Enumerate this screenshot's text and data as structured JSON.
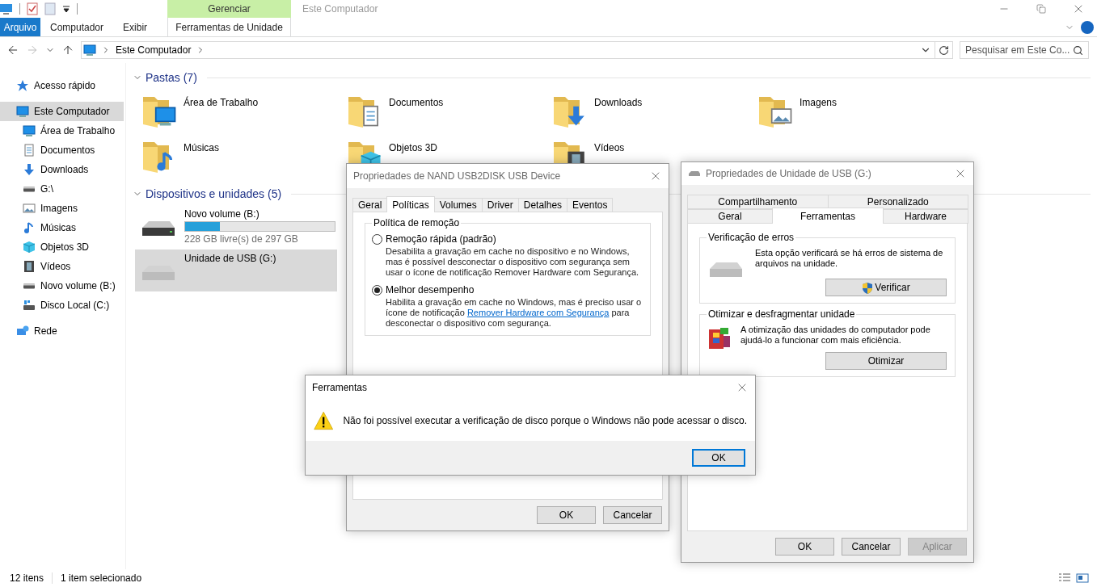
{
  "explorer": {
    "context_group": "Gerenciar",
    "title": "Este Computador",
    "ribbon_tabs": [
      {
        "label": "Arquivo",
        "kind": "file"
      },
      {
        "label": "Computador",
        "kind": "plain"
      },
      {
        "label": "Exibir",
        "kind": "plain"
      },
      {
        "label": "Ferramentas de Unidade",
        "kind": "context"
      }
    ],
    "address": {
      "path": [
        "Este Computador"
      ]
    },
    "search": {
      "placeholder": "Pesquisar em Este Co..."
    },
    "sidebar": {
      "items": [
        {
          "label": "Acesso rápido",
          "kind": "star",
          "selected": false
        },
        {
          "label": "Este Computador",
          "kind": "pc",
          "selected": true,
          "children": [
            {
              "label": "Área de Trabalho",
              "kind": "desktop",
              "selected": false
            },
            {
              "label": "Documentos",
              "kind": "documents",
              "selected": false
            },
            {
              "label": "Downloads",
              "kind": "downloads",
              "selected": false
            },
            {
              "label": "G:\\",
              "kind": "drive",
              "selected": false
            },
            {
              "label": "Imagens",
              "kind": "pictures",
              "selected": false
            },
            {
              "label": "Músicas",
              "kind": "music",
              "selected": false
            },
            {
              "label": "Objetos 3D",
              "kind": "objects3d",
              "selected": false
            },
            {
              "label": "Vídeos",
              "kind": "videos",
              "selected": false
            },
            {
              "label": "Novo volume (B:)",
              "kind": "drive",
              "selected": false
            },
            {
              "label": "Disco Local (C:)",
              "kind": "localdisk",
              "selected": false
            }
          ]
        },
        {
          "label": "Rede",
          "kind": "network",
          "selected": false
        }
      ]
    },
    "sections": [
      {
        "title": "Pastas (7)",
        "kind": "folders",
        "expanded": true,
        "items": [
          {
            "label": "Área de Trabalho",
            "kind": "desktop",
            "selected": false
          },
          {
            "label": "Documentos",
            "kind": "documents",
            "selected": false
          },
          {
            "label": "Downloads",
            "kind": "downloads",
            "selected": false
          },
          {
            "label": "Imagens",
            "kind": "pictures",
            "selected": false
          },
          {
            "label": "Músicas",
            "kind": "music",
            "selected": false
          },
          {
            "label": "Objetos 3D",
            "kind": "objects3d",
            "selected": false
          },
          {
            "label": "Vídeos",
            "kind": "videos",
            "selected": false
          }
        ]
      },
      {
        "title": "Dispositivos e unidades (5)",
        "kind": "drives",
        "expanded": true,
        "items": [
          {
            "label": "Novo volume (B:)",
            "kind": "hdd",
            "selected": false,
            "level": 0.23,
            "free": "228 GB livre(s) de 297 GB"
          },
          {
            "label": "Unidade de USB (G:)",
            "kind": "usb",
            "selected": true
          }
        ]
      }
    ],
    "status_bar": {
      "count": "12 itens",
      "selection": "1 item selecionado"
    }
  },
  "device_properties": {
    "title": "Propriedades de NAND USB2DISK USB Device",
    "tabs": [
      {
        "label": "Geral",
        "selected": false
      },
      {
        "label": "Políticas",
        "selected": true
      },
      {
        "label": "Volumes",
        "selected": false
      },
      {
        "label": "Driver",
        "selected": false
      },
      {
        "label": "Detalhes",
        "selected": false
      },
      {
        "label": "Eventos",
        "selected": false
      }
    ],
    "group": {
      "title": "Política de remoção",
      "options": [
        {
          "label": "Remoção rápida (padrão)",
          "selected": false,
          "description": "Desabilita a gravação em cache no dispositivo e no Windows, mas é possível desconectar o dispositivo com segurança sem usar o ícone de notificação Remover Hardware com Segurança."
        },
        {
          "label": "Melhor desempenho",
          "selected": true,
          "description": "Habilita a gravação em cache no Windows, mas é preciso usar o ícone de notificação",
          "link": "Remover Hardware com Segurança",
          "description_end": "para desconectar o dispositivo com segurança."
        }
      ]
    },
    "buttons": [
      {
        "label": "OK",
        "disabled": false
      },
      {
        "label": "Cancelar",
        "disabled": false
      }
    ]
  },
  "drive_properties": {
    "title": "Propriedades de Unidade de USB (G:)",
    "tab_rows": [
      {
        "tabs": [
          {
            "label": "Compartilhamento",
            "selected": false
          },
          {
            "label": "Personalizado",
            "selected": false
          }
        ]
      },
      {
        "tabs": [
          {
            "label": "Geral",
            "selected": false
          },
          {
            "label": "Ferramentas",
            "selected": true
          },
          {
            "label": "Hardware",
            "selected": false
          }
        ]
      }
    ],
    "groups": [
      {
        "title": "Verificação de erros",
        "kind": "check",
        "text": "Esta opção verificará se há erros de sistema de arquivos na unidade.",
        "button": {
          "label": "Verificar",
          "shield": true
        }
      },
      {
        "title": "Otimizar e desfragmentar unidade",
        "kind": "optimize",
        "text": "A otimização das unidades do computador pode ajudá-lo a funcionar com mais eficiência.",
        "button": {
          "label": "Otimizar",
          "shield": false
        }
      }
    ],
    "buttons": [
      {
        "label": "OK",
        "disabled": false
      },
      {
        "label": "Cancelar",
        "disabled": false
      },
      {
        "label": "Aplicar",
        "disabled": true
      }
    ]
  },
  "error_dialog": {
    "title": "Ferramentas",
    "message": "Não foi possível executar a verificação de disco porque o Windows não pode acessar o disco.",
    "buttons": [
      {
        "label": "OK",
        "default": true
      }
    ]
  }
}
